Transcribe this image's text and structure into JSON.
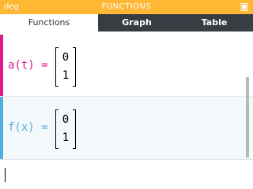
{
  "status_bar": {
    "angle_mode": "deg",
    "title": "FUNCTIONS",
    "battery_icon": "battery-icon",
    "color": "#ffb734"
  },
  "tabs": [
    {
      "label": "Functions",
      "active": true
    },
    {
      "label": "Graph",
      "active": false
    },
    {
      "label": "Table",
      "active": false
    }
  ],
  "functions": [
    {
      "name": "a(t) =",
      "color": "#e1178a",
      "matrix": [
        "0",
        "1"
      ]
    },
    {
      "name": "f(x) =",
      "color": "#4fb0e0",
      "matrix": [
        "0",
        "1"
      ]
    }
  ],
  "input": {
    "value": ""
  }
}
